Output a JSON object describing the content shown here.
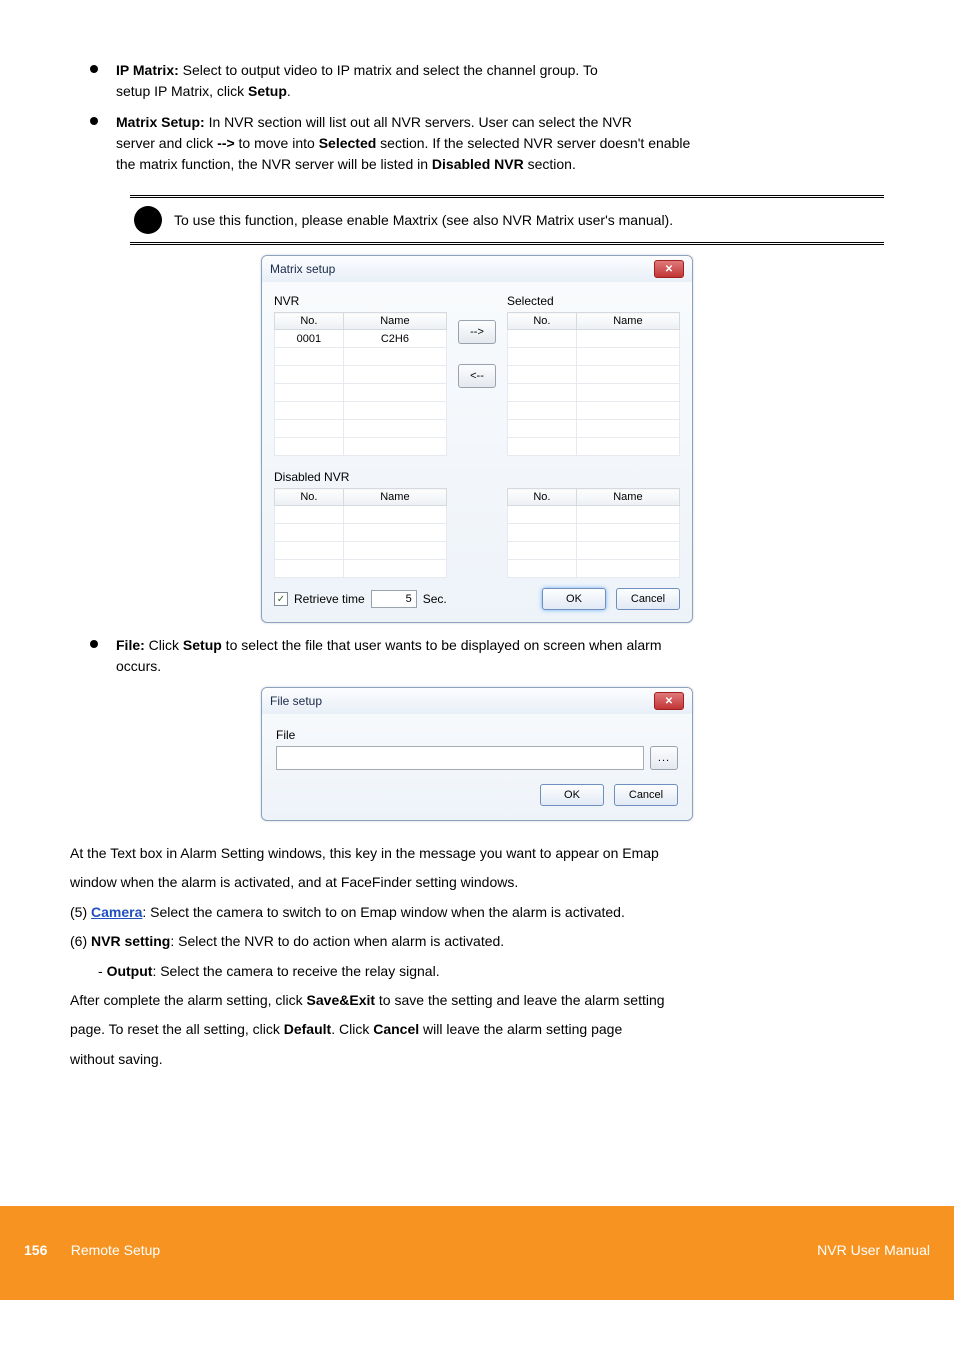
{
  "bullets": {
    "item1_label": "IP Matrix:",
    "item1_text": " Select to output video to IP matrix and select the channel group. To",
    "item1_line2": "setup IP Matrix, click ",
    "item1_setup": "Setup",
    "item1_after": ".",
    "item2_label": "Matrix Setup:",
    "item2_text": " In NVR section will list out all NVR servers. User can select the NVR",
    "item2_line2": "server and click ",
    "item2_arrow": "-->",
    "item2_line2b": " to move into ",
    "item2_selected": "Selected",
    "item2_line2c": " section. If the selected NVR server doesn't enable",
    "item2_line3": "the matrix function, the NVR server will be listed in ",
    "item2_disabled": "Disabled NVR",
    "item2_line3b": " section.",
    "item3_label": "File:",
    "item3_text": " Click ",
    "item3_setup": "Setup",
    "item3_text2": " to select the file that user wants to be displayed on screen when alarm",
    "item3_line2": "occurs."
  },
  "note": {
    "text": "To use this function, please enable Maxtrix (see also NVR Matrix user's manual)."
  },
  "matrix_dialog": {
    "title": "Matrix setup",
    "nvr_label": "NVR",
    "selected_label": "Selected",
    "disabled_label": "Disabled NVR",
    "col_no": "No.",
    "col_name": "Name",
    "row_no": "0001",
    "row_name": "C2H6",
    "arrow_right": "-->",
    "arrow_left": "<--",
    "retrieve_label": "Retrieve time",
    "retrieve_value": "5",
    "sec_label": "Sec.",
    "ok": "OK",
    "cancel": "Cancel"
  },
  "file_dialog": {
    "title": "File setup",
    "file_label": "File",
    "browse": "...",
    "ok": "OK",
    "cancel": "Cancel"
  },
  "body": {
    "p1a": "At the Text box in Alarm Setting windows, this key in the message you want to appear on Emap",
    "p1b": "window when the alarm is activated, and at FaceFinder setting windows.",
    "p2a": "(5) ",
    "p2b": "Camera",
    "p2c": ": Select the camera to switch to on Emap window when the alarm is activated.",
    "p3a": "(6) ",
    "p3b": "NVR setting",
    "p3c": ": Select the NVR to do action when alarm is activated.",
    "p4_indent": "- ",
    "p4b": "Output",
    "p4c": ": Select the camera to receive the relay signal.",
    "p5a": "After complete the alarm setting, click ",
    "p5b": "Save&Exit",
    "p5c": " to save the setting and leave the alarm setting",
    "p5d": "page. To reset the all setting, click ",
    "p5e": "Default",
    "p5f": ". Click ",
    "p5g": "Cancel",
    "p5h": " will leave the alarm setting page",
    "p5i": "without saving."
  },
  "footer": {
    "page": "156",
    "left": "Remote Setup",
    "right": "NVR User Manual"
  }
}
